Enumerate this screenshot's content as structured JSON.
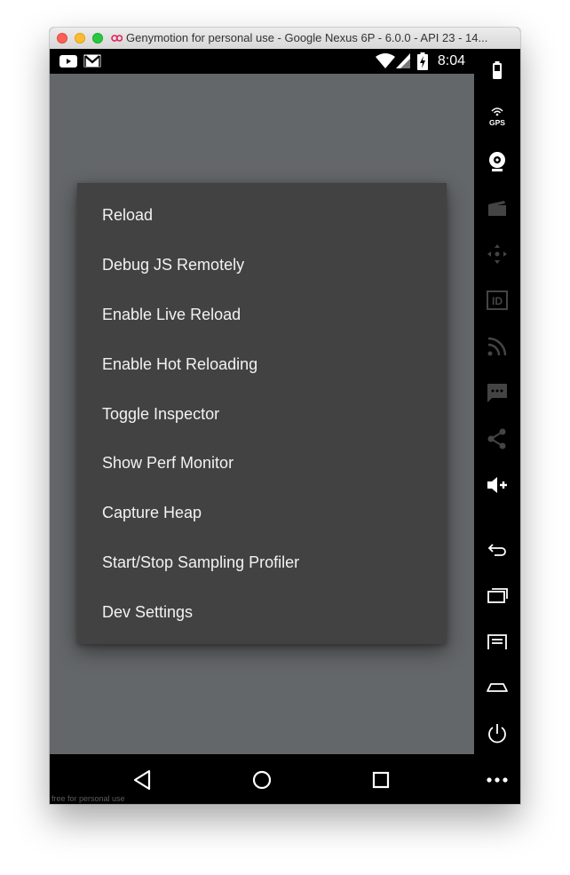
{
  "window": {
    "title": "Genymotion for personal use - Google Nexus 6P - 6.0.0 - API 23 - 14..."
  },
  "status_bar": {
    "time": "8:04",
    "icons": [
      "youtube-icon",
      "gmail-icon",
      "wifi-icon",
      "signal-icon",
      "battery-charging-icon"
    ]
  },
  "dev_menu": {
    "items": [
      "Reload",
      "Debug JS Remotely",
      "Enable Live Reload",
      "Enable Hot Reloading",
      "Toggle Inspector",
      "Show Perf Monitor",
      "Capture Heap",
      "Start/Stop Sampling Profiler",
      "Dev Settings"
    ]
  },
  "nav_bar": {
    "buttons": [
      "back-icon",
      "home-icon",
      "recents-icon"
    ],
    "watermark": "free for personal use"
  },
  "sidebar": {
    "tools": [
      "battery-icon",
      "gps-icon",
      "webcam-icon",
      "screencast-icon",
      "move-icon",
      "identifiers-icon",
      "network-icon",
      "sms-icon",
      "share-icon",
      "volume-up-icon",
      "back-icon",
      "recent-apps-icon",
      "menu-icon",
      "home-icon",
      "power-icon",
      "more-icon"
    ],
    "gps_label": "GPS",
    "id_label": "ID"
  },
  "colors": {
    "screen_bg": "#646769",
    "menu_bg": "#424242",
    "menu_text": "#f2f2f2"
  }
}
